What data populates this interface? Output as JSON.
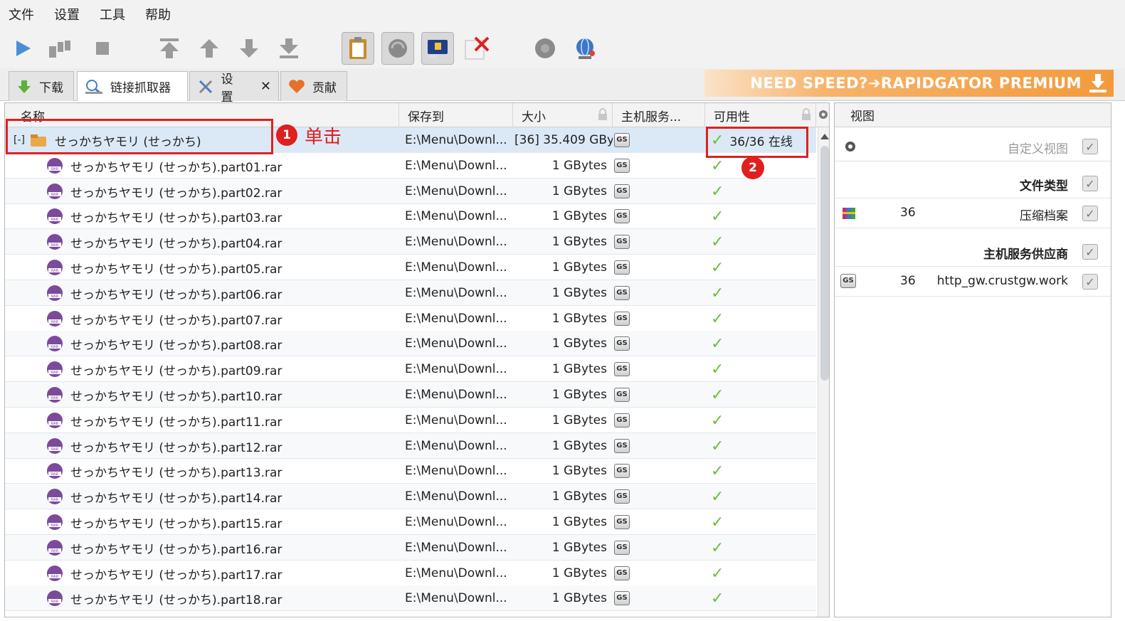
{
  "menu": [
    "文件",
    "设置",
    "工具",
    "帮助"
  ],
  "tabs": [
    {
      "label": "下载"
    },
    {
      "label": "链接抓取器"
    },
    {
      "label": "设置",
      "close": "✕"
    },
    {
      "label": "贡献"
    }
  ],
  "banner": "NEED SPEED?➔RAPIDGATOR PREMIUM",
  "columns": {
    "name": "名称",
    "saveto": "保存到",
    "size": "大小",
    "host": "主机服务...",
    "avail": "可用性"
  },
  "package": {
    "expander": "[-]",
    "name": "せっかちヤモリ (せっかち)",
    "saveto": "E:\\Menu\\Downl...",
    "size": "[36]  35.409 GBy",
    "host": "GS",
    "avail": "36/36 在线"
  },
  "files": [
    {
      "name": "せっかちヤモリ (せっかち).part01.rar",
      "saveto": "E:\\Menu\\Downl...",
      "size": "1 GBytes",
      "host": "GS"
    },
    {
      "name": "せっかちヤモリ (せっかち).part02.rar",
      "saveto": "E:\\Menu\\Downl...",
      "size": "1 GBytes",
      "host": "GS"
    },
    {
      "name": "せっかちヤモリ (せっかち).part03.rar",
      "saveto": "E:\\Menu\\Downl...",
      "size": "1 GBytes",
      "host": "GS"
    },
    {
      "name": "せっかちヤモリ (せっかち).part04.rar",
      "saveto": "E:\\Menu\\Downl...",
      "size": "1 GBytes",
      "host": "GS"
    },
    {
      "name": "せっかちヤモリ (せっかち).part05.rar",
      "saveto": "E:\\Menu\\Downl...",
      "size": "1 GBytes",
      "host": "GS"
    },
    {
      "name": "せっかちヤモリ (せっかち).part06.rar",
      "saveto": "E:\\Menu\\Downl...",
      "size": "1 GBytes",
      "host": "GS"
    },
    {
      "name": "せっかちヤモリ (せっかち).part07.rar",
      "saveto": "E:\\Menu\\Downl...",
      "size": "1 GBytes",
      "host": "GS"
    },
    {
      "name": "せっかちヤモリ (せっかち).part08.rar",
      "saveto": "E:\\Menu\\Downl...",
      "size": "1 GBytes",
      "host": "GS"
    },
    {
      "name": "せっかちヤモリ (せっかち).part09.rar",
      "saveto": "E:\\Menu\\Downl...",
      "size": "1 GBytes",
      "host": "GS"
    },
    {
      "name": "せっかちヤモリ (せっかち).part10.rar",
      "saveto": "E:\\Menu\\Downl...",
      "size": "1 GBytes",
      "host": "GS"
    },
    {
      "name": "せっかちヤモリ (せっかち).part11.rar",
      "saveto": "E:\\Menu\\Downl...",
      "size": "1 GBytes",
      "host": "GS"
    },
    {
      "name": "せっかちヤモリ (せっかち).part12.rar",
      "saveto": "E:\\Menu\\Downl...",
      "size": "1 GBytes",
      "host": "GS"
    },
    {
      "name": "せっかちヤモリ (せっかち).part13.rar",
      "saveto": "E:\\Menu\\Downl...",
      "size": "1 GBytes",
      "host": "GS"
    },
    {
      "name": "せっかちヤモリ (せっかち).part14.rar",
      "saveto": "E:\\Menu\\Downl...",
      "size": "1 GBytes",
      "host": "GS"
    },
    {
      "name": "せっかちヤモリ (せっかち).part15.rar",
      "saveto": "E:\\Menu\\Downl...",
      "size": "1 GBytes",
      "host": "GS"
    },
    {
      "name": "せっかちヤモリ (せっかち).part16.rar",
      "saveto": "E:\\Menu\\Downl...",
      "size": "1 GBytes",
      "host": "GS"
    },
    {
      "name": "せっかちヤモリ (せっかち).part17.rar",
      "saveto": "E:\\Menu\\Downl...",
      "size": "1 GBytes",
      "host": "GS"
    },
    {
      "name": "せっかちヤモリ (せっかち).part18.rar",
      "saveto": "E:\\Menu\\Downl...",
      "size": "1 GBytes",
      "host": "GS"
    }
  ],
  "view": {
    "title": "视图",
    "custom": "自定义视图",
    "filetype": "文件类型",
    "archive": {
      "count": "36",
      "label": "压缩档案"
    },
    "host_header": "主机服务供应商",
    "host": {
      "icon": "GS",
      "count": "36",
      "label": "http_gw.crustgw.work"
    }
  },
  "annotations": {
    "step1": "1",
    "step1_text": "单击",
    "step2": "2"
  },
  "colors": {
    "accent_red": "#e0201e",
    "check_green": "#6fbf3a",
    "banner_orange": "#f39a3c",
    "selected_row": "#dbe9f7"
  }
}
